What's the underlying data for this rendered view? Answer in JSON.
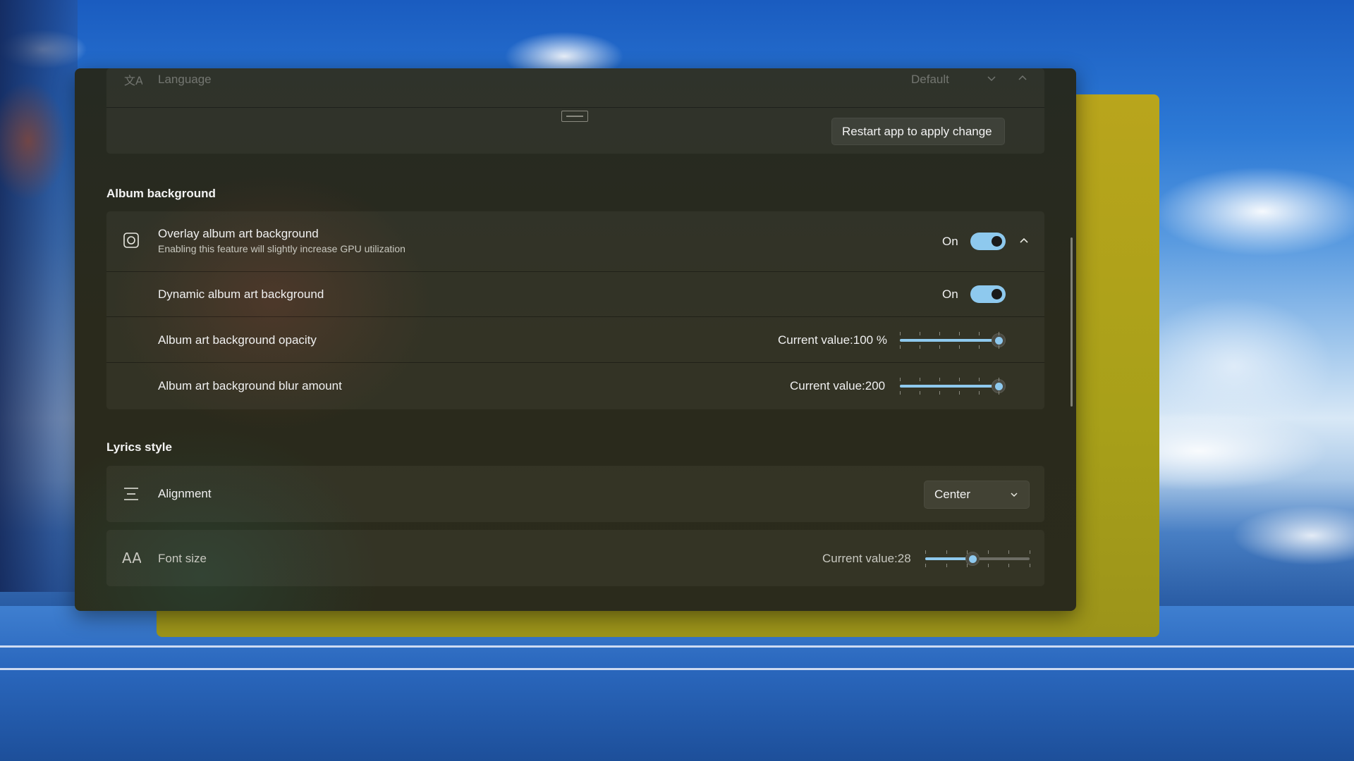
{
  "language_row": {
    "label": "Language",
    "value": "Default",
    "restart_button": "Restart app to apply change"
  },
  "album_background": {
    "section_title": "Album background",
    "overlay": {
      "label": "Overlay album art background",
      "description": "Enabling this feature will slightly increase GPU utilization",
      "state": "On",
      "enabled": true
    },
    "dynamic": {
      "label": "Dynamic album art background",
      "state": "On",
      "enabled": true
    },
    "opacity": {
      "label": "Album art background opacity",
      "value_text": "Current value:100 %",
      "fraction": 1.0
    },
    "blur": {
      "label": "Album art background blur amount",
      "value_text": "Current value:200",
      "fraction": 1.0
    }
  },
  "lyrics_style": {
    "section_title": "Lyrics style",
    "alignment": {
      "label": "Alignment",
      "selected": "Center"
    },
    "font_size": {
      "label": "Font size",
      "value_text": "Current value:28",
      "fraction": 0.45
    }
  },
  "colors": {
    "accent": "#8ec9ee",
    "panel": "#2a2a1c",
    "back_window": "#b0a21b"
  }
}
